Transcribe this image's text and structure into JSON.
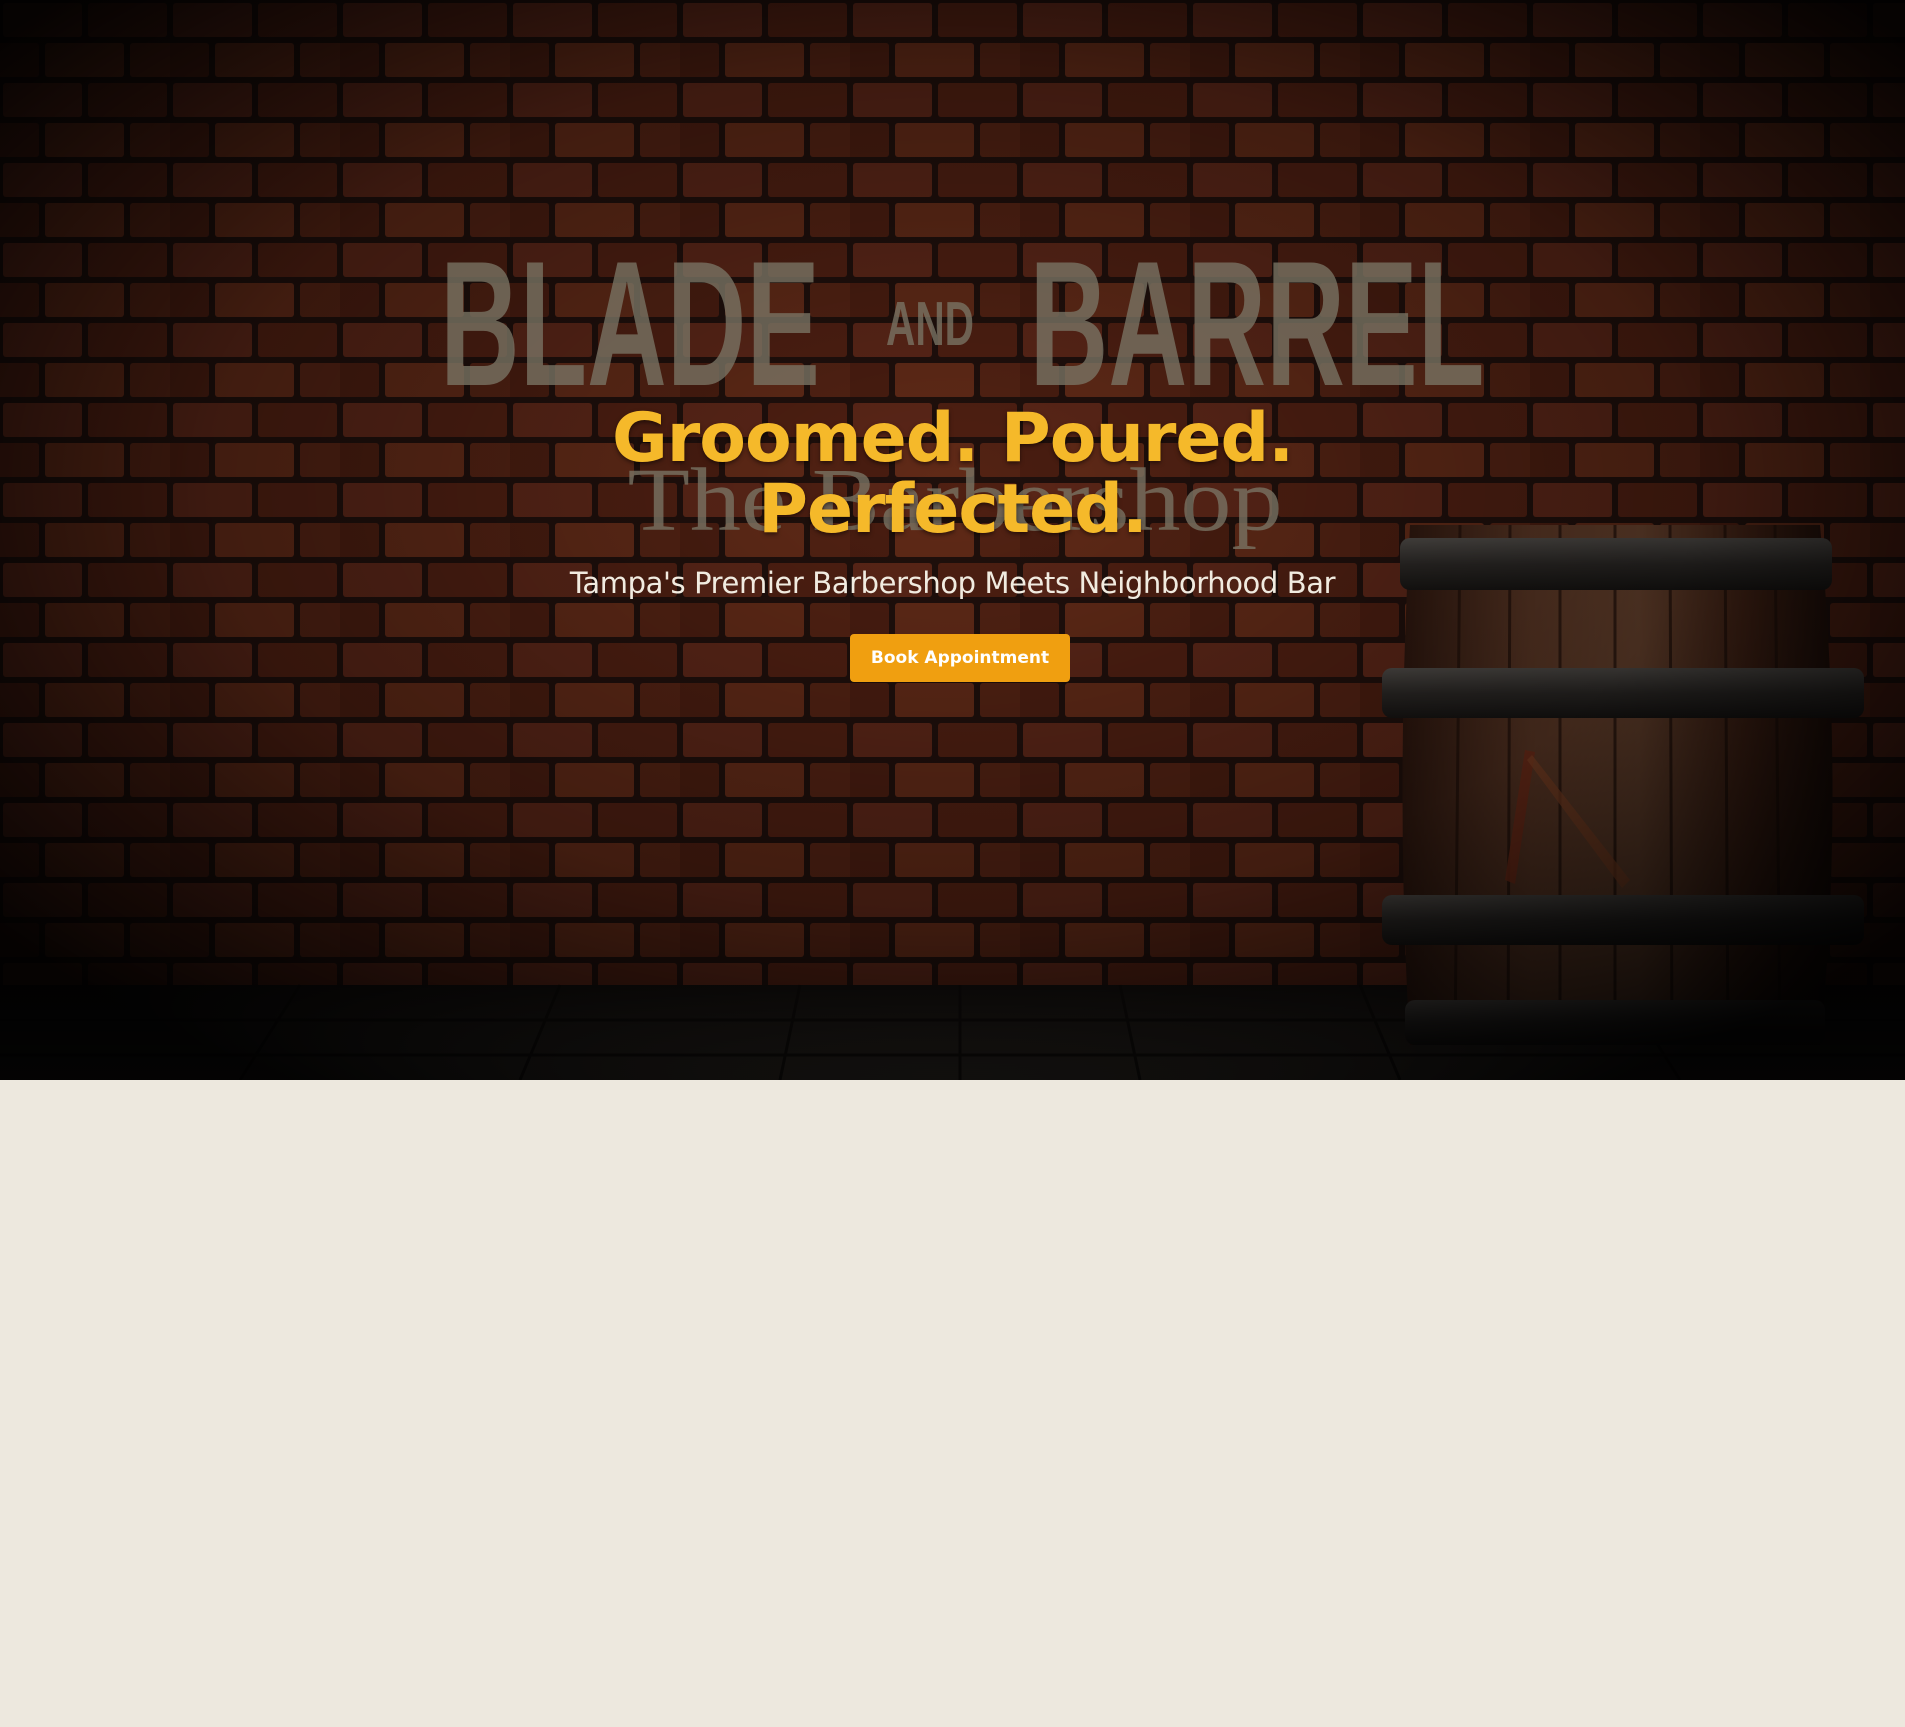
{
  "brand": {
    "logo_text_main_left": "BLADE",
    "logo_text_and": "AND",
    "logo_text_main_right": "BARREL",
    "logo_text_sub": "The Barbershop"
  },
  "hero": {
    "headline_line_1": "Groomed. Poured.",
    "headline_line_2": "Perfected.",
    "tagline": "Tampa's Premier Barbershop Meets Neighborhood Bar",
    "cta_label": "Book Appointment"
  },
  "colors": {
    "accent": "#f5b92a",
    "button": "#f09f10",
    "page_background": "#ede8de",
    "brick": "#6b2a19"
  }
}
